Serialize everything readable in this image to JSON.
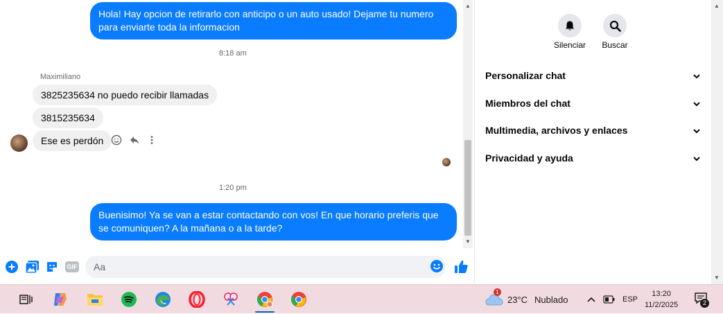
{
  "messages": {
    "m1": "Hola! Hay opcion de retirarlo con anticipo o un auto usado! Dejame tu numero para enviarte toda la informacion",
    "time1": "8:18 am",
    "sender": "Maximiliano",
    "m2": "3825235634 no puedo recibir llamadas",
    "m3": "3815235634",
    "m4": "Ese es perdón",
    "time2": "1:20 pm",
    "m5": "Buenisimo! Ya se van a estar contactando con vos! En que horario preferis que se comuniquen? A la mañana o a la tarde?"
  },
  "composer": {
    "placeholder": "Aa",
    "gif_label": "GIF"
  },
  "panel": {
    "mute_label": "Silenciar",
    "search_label": "Buscar",
    "sections": [
      "Personalizar chat",
      "Miembros del chat",
      "Multimedia, archivos y enlaces",
      "Privacidad y ayuda"
    ]
  },
  "taskbar": {
    "weather_badge": "1",
    "temperature": "23°C",
    "weather_text": "Nublado",
    "language": "ESP",
    "time": "13:20",
    "date": "11/2/2025",
    "notif_count": "2"
  },
  "colors": {
    "accent": "#0a7cff",
    "incoming": "#f0f0f0",
    "taskbar": "#f1dbe0"
  },
  "icons": [
    "plus-icon",
    "photo-icon",
    "sticker-icon",
    "gif-icon",
    "emoji-icon",
    "like-icon",
    "bell-icon",
    "search-icon",
    "chevron-down-icon",
    "react-icon",
    "reply-icon",
    "more-icon"
  ]
}
